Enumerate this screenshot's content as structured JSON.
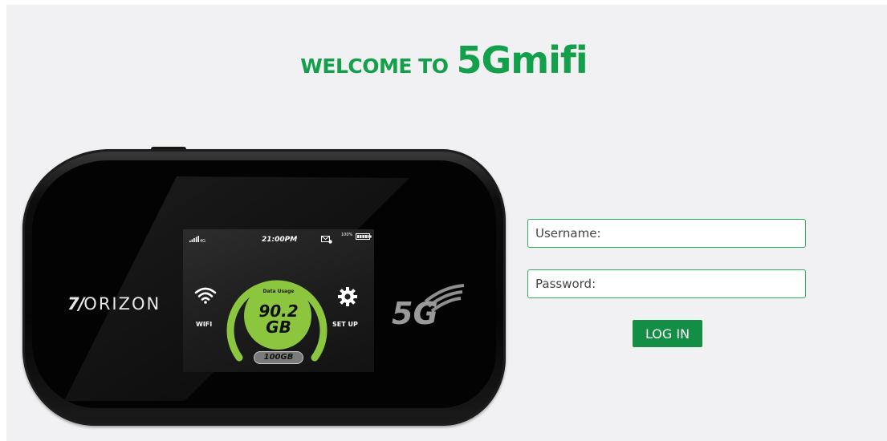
{
  "header": {
    "welcome_prefix": "WELCOME TO",
    "welcome_brand": "5Gmifi"
  },
  "device": {
    "brand": "ORIZON",
    "network_logo": "5G",
    "screen": {
      "network_type": "4G",
      "time": "21:00PM",
      "message_icon": "envelope-icon",
      "battery_percent": "100%",
      "wifi_label": "WIFI",
      "setup_label": "SET UP",
      "usage_title": "Data Usage",
      "usage_value_line1": "90.2",
      "usage_value_line2": "GB",
      "usage_total": "100GB",
      "usage_fraction": 0.902
    }
  },
  "login": {
    "username_placeholder": "Username:",
    "password_placeholder": "Password:",
    "button_label": "LOG IN"
  },
  "colors": {
    "brand_green": "#13a04a",
    "button_green": "#138f45",
    "field_border": "#2fae58",
    "gauge_green": "#8cc63f",
    "page_background": "#f1f1f3"
  }
}
